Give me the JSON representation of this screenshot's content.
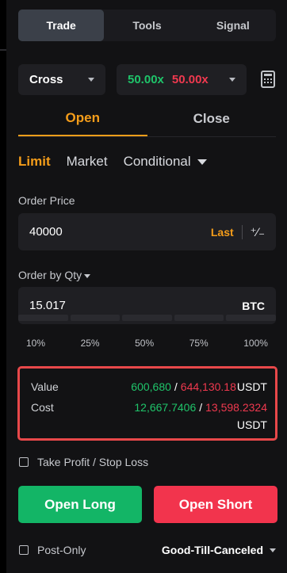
{
  "tabs": {
    "items": [
      "Trade",
      "Tools",
      "Signal"
    ],
    "active": "Trade"
  },
  "margin_mode": {
    "value": "Cross"
  },
  "leverage": {
    "buy": "50.00x",
    "sell": "50.00x"
  },
  "icons": {
    "calculator": "calculator-icon",
    "plus_minus": "plus-minus-icon"
  },
  "position_tabs": {
    "open": "Open",
    "close": "Close",
    "active": "Open"
  },
  "order_types": {
    "limit": "Limit",
    "market": "Market",
    "conditional": "Conditional",
    "active": "Limit"
  },
  "order_price": {
    "label": "Order Price",
    "value": "40000",
    "last_button": "Last",
    "plus_minus_glyph": "⁺∕₋"
  },
  "order_qty": {
    "label": "Order by Qty",
    "value": "15.017",
    "unit": "BTC"
  },
  "percent_options": [
    "10%",
    "25%",
    "50%",
    "75%",
    "100%"
  ],
  "summary": {
    "value_label": "Value",
    "value_buy": "600,680",
    "value_sell": "644,130.18",
    "value_unit": "USDT",
    "cost_label": "Cost",
    "cost_buy": "12,667.7406",
    "cost_sell": "13,598.2324",
    "cost_unit": "USDT",
    "slash": "/"
  },
  "tp_sl": {
    "label": "Take Profit / Stop Loss",
    "checked": false
  },
  "actions": {
    "long": "Open Long",
    "short": "Open Short"
  },
  "post_only": {
    "label": "Post-Only",
    "checked": false
  },
  "time_in_force": {
    "value": "Good-Till-Canceled"
  },
  "colors": {
    "accent": "#f59d1a",
    "buy": "#1fc46a",
    "sell": "#f0394f",
    "highlight_border": "#e8484a"
  }
}
